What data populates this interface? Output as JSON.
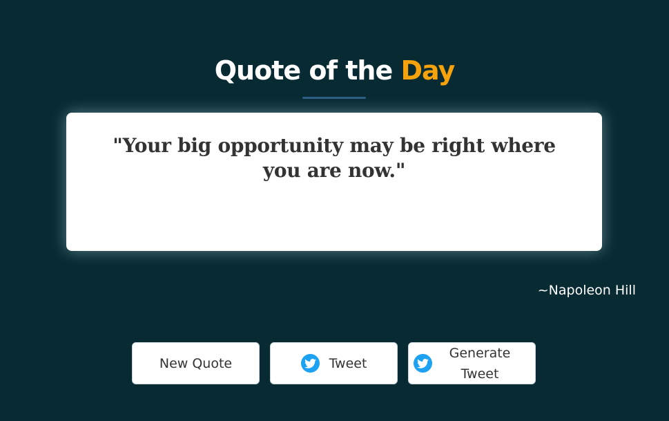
{
  "header": {
    "title_main": "Quote of the ",
    "title_accent": "Day",
    "accent_color": "#f5a20c"
  },
  "quote": {
    "text": "\"Your big opportunity may be right where you are now.\"",
    "author": "~Napoleon Hill"
  },
  "buttons": {
    "new_quote": "New Quote",
    "tweet": "Tweet",
    "generate_line1": "Generate",
    "generate_line2": "Tweet",
    "icon": "twitter-icon",
    "icon_color": "#1da1f2"
  },
  "theme": {
    "background": "#082b33",
    "card": "#ffffff"
  }
}
